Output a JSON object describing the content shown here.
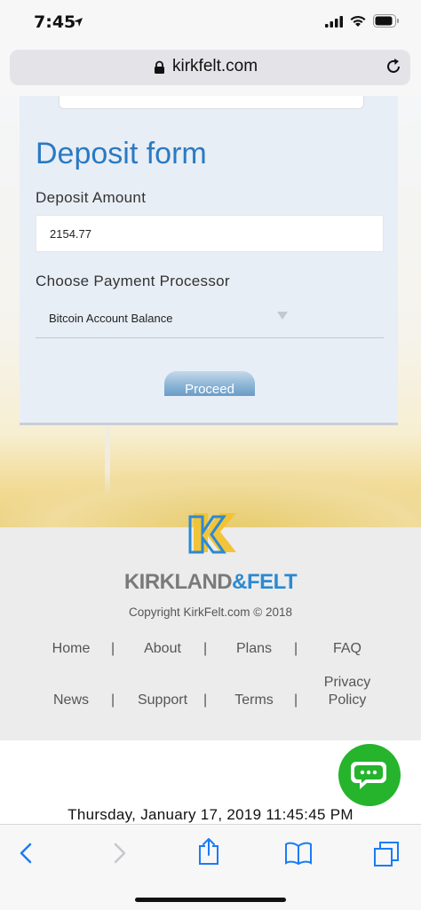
{
  "status_bar": {
    "time": "7:45"
  },
  "browser": {
    "url": "kirkfelt.com"
  },
  "deposit_form": {
    "title": "Deposit form",
    "amount_label": "Deposit Amount",
    "amount_value": "2154.77",
    "processor_label": "Choose Payment Processor",
    "processor_value": "Bitcoin Account Balance",
    "proceed_label": "Proceed"
  },
  "footer": {
    "logo_part1": "KIRKLAND",
    "logo_part2": "&FELT",
    "copyright": "Copyright KirkFelt.com © 2018",
    "nav": [
      "Home",
      "About",
      "Plans",
      "FAQ",
      "News",
      "Support",
      "Terms",
      "Privacy Policy"
    ],
    "separator": "|"
  },
  "datetime": "Thursday, January 17, 2019 11:45:45 PM",
  "colors": {
    "accent": "#2a7ac2",
    "chat": "#25b42c",
    "ios_blue": "#1a7cf5"
  },
  "icons": [
    "location-arrow-icon",
    "signal-icon",
    "wifi-icon",
    "battery-icon",
    "lock-icon",
    "reload-icon",
    "chat-icon",
    "back-icon",
    "forward-icon",
    "share-icon",
    "bookmarks-icon",
    "tabs-icon"
  ]
}
